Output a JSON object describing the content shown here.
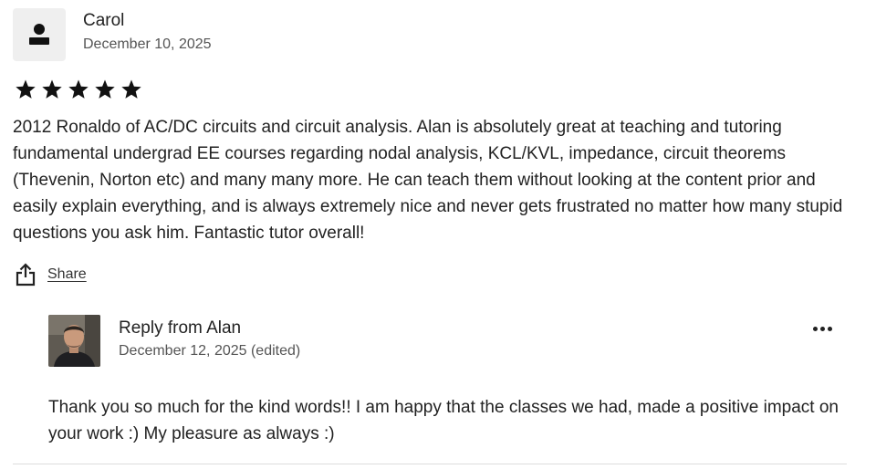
{
  "review": {
    "reviewer_name": "Carol",
    "date": "December 10, 2025",
    "rating": 5,
    "rating_max": 5,
    "avatar_icon": "person-icon",
    "body": "2012 Ronaldo of AC/DC circuits and circuit analysis. Alan is absolutely great at teaching and tutoring fundamental undergrad EE courses regarding nodal analysis, KCL/KVL, impedance, circuit theorems (Thevenin, Norton etc) and many many more. He can teach them without looking at the content prior and easily explain everything, and is always extremely nice and never gets frustrated no matter how many stupid questions you ask him. Fantastic tutor overall!",
    "share_label": "Share",
    "share_icon": "share-icon"
  },
  "reply": {
    "title": "Reply from Alan",
    "date": "December 12, 2025 (edited)",
    "body": "Thank you so much for the kind words!! I am happy that the classes we had, made a positive impact on your work :) My pleasure as always :)",
    "more_icon": "more-options-icon"
  },
  "colors": {
    "text": "#222222",
    "muted": "#555555",
    "star": "#111111",
    "avatar_bg": "#efefef",
    "divider": "#dddddd"
  }
}
